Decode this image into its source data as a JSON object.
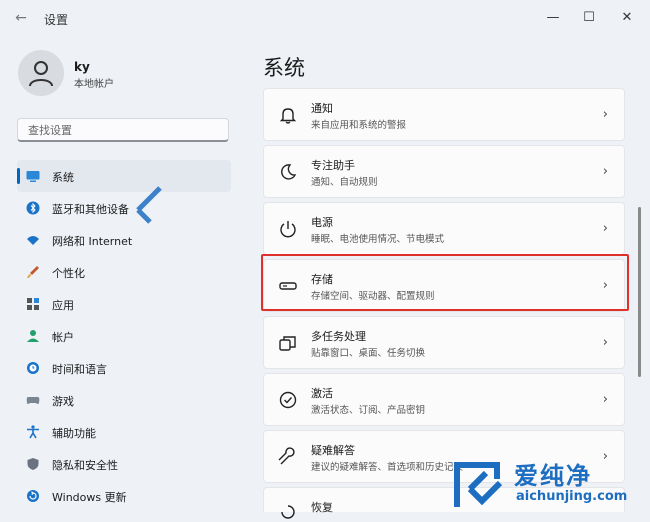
{
  "window": {
    "title": "设置",
    "back_icon": "←",
    "minimize_icon": "—",
    "maximize_icon": "☐",
    "close_icon": "✕"
  },
  "account": {
    "name": "ky",
    "type": "本地帐户"
  },
  "search": {
    "placeholder": "查找设置"
  },
  "nav": [
    {
      "label": "系统",
      "icon": "monitor-icon",
      "active": true
    },
    {
      "label": "蓝牙和其他设备",
      "icon": "bluetooth-icon"
    },
    {
      "label": "网络和 Internet",
      "icon": "wifi-icon"
    },
    {
      "label": "个性化",
      "icon": "brush-icon"
    },
    {
      "label": "应用",
      "icon": "apps-icon"
    },
    {
      "label": "帐户",
      "icon": "person-icon"
    },
    {
      "label": "时间和语言",
      "icon": "clock-globe-icon"
    },
    {
      "label": "游戏",
      "icon": "gamepad-icon"
    },
    {
      "label": "辅助功能",
      "icon": "accessibility-icon"
    },
    {
      "label": "隐私和安全性",
      "icon": "shield-icon"
    },
    {
      "label": "Windows 更新",
      "icon": "update-icon"
    }
  ],
  "page": {
    "title": "系统"
  },
  "cards": [
    {
      "title": "通知",
      "desc": "来自应用和系统的警报",
      "icon": "bell-icon"
    },
    {
      "title": "专注助手",
      "desc": "通知、自动规则",
      "icon": "moon-icon"
    },
    {
      "title": "电源",
      "desc": "睡眠、电池使用情况、节电模式",
      "icon": "power-icon"
    },
    {
      "title": "存储",
      "desc": "存储空间、驱动器、配置规则",
      "icon": "drive-icon"
    },
    {
      "title": "多任务处理",
      "desc": "贴靠窗口、桌面、任务切换",
      "icon": "multitask-icon"
    },
    {
      "title": "激活",
      "desc": "激活状态、订阅、产品密钥",
      "icon": "check-circle-icon"
    },
    {
      "title": "疑难解答",
      "desc": "建议的疑难解答、首选项和历史记录",
      "icon": "wrench-icon"
    },
    {
      "title": "恢复",
      "desc": "",
      "icon": "recovery-icon"
    }
  ],
  "watermark": {
    "cn": "爱纯净",
    "en": "aichunjing.com"
  }
}
